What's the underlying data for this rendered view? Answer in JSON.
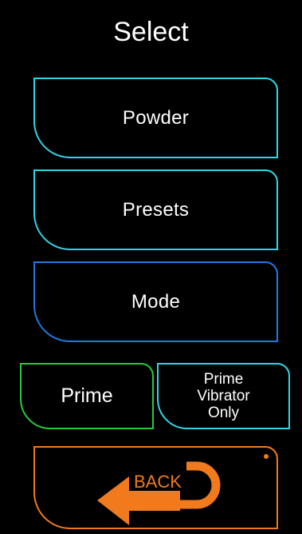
{
  "header": {
    "title": "Select"
  },
  "menu": {
    "powder_label": "Powder",
    "presets_label": "Presets",
    "mode_label": "Mode",
    "prime_label": "Prime",
    "prime_vibrator_lines": [
      "Prime",
      "Vibrator",
      "Only"
    ],
    "back_label": "BACK"
  },
  "icons": {
    "back": "u-turn-arrow-left-icon"
  },
  "colors": {
    "background": "#000000",
    "cyan_border": "#2fd6e8",
    "blue_border": "#1f7ae0",
    "green_border": "#22cc3c",
    "orange_accent": "#f07a1c",
    "text": "#ffffff"
  }
}
